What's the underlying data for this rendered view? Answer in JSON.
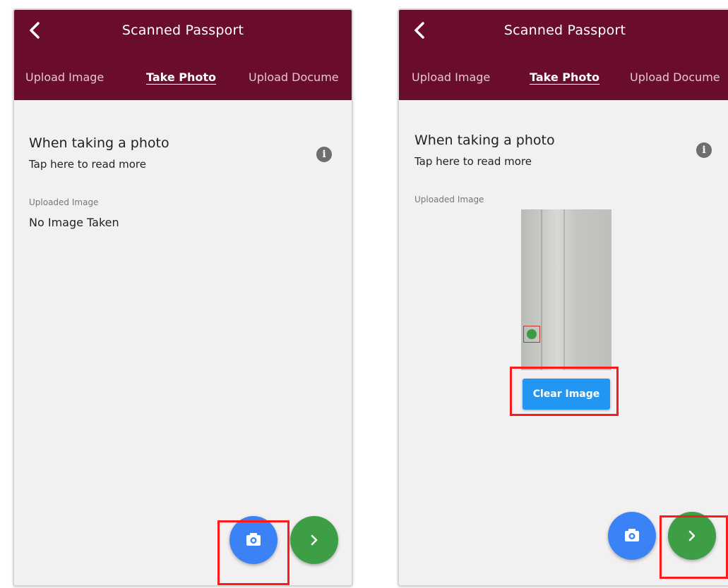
{
  "screens": [
    {
      "id": "before",
      "appbar": {
        "title": "Scanned Passport",
        "back_icon": "chevron-left-icon"
      },
      "tabs": [
        {
          "label": "Upload Image",
          "active": false
        },
        {
          "label": "Take Photo",
          "active": true
        },
        {
          "label": "Upload Docume",
          "active": false
        }
      ],
      "info": {
        "title": "When taking a photo",
        "subtitle": "Tap here to read more",
        "icon": "info-icon"
      },
      "uploaded_label": "Uploaded Image",
      "image_status": "No Image Taken",
      "fabs": [
        {
          "icon": "camera-icon",
          "color": "#3b82f6",
          "highlighted": true
        },
        {
          "icon": "chevron-right-icon",
          "color": "#3e9e46",
          "highlighted": false
        }
      ]
    },
    {
      "id": "after",
      "appbar": {
        "title": "Scanned Passport",
        "back_icon": "chevron-left-icon"
      },
      "tabs": [
        {
          "label": "Upload Image",
          "active": false
        },
        {
          "label": "Take Photo",
          "active": true
        },
        {
          "label": "Upload Docume",
          "active": false
        }
      ],
      "info": {
        "title": "When taking a photo",
        "subtitle": "Tap here to read more",
        "icon": "info-icon"
      },
      "uploaded_label": "Uploaded Image",
      "clear_button": {
        "label": "Clear Image",
        "color": "#2196f3",
        "highlighted": true
      },
      "fabs": [
        {
          "icon": "camera-icon",
          "color": "#3b82f6",
          "highlighted": false
        },
        {
          "icon": "chevron-right-icon",
          "color": "#3e9e46",
          "highlighted": true
        }
      ]
    }
  ],
  "colors": {
    "appbar": "#6a0c2e",
    "background": "#f2f0f1",
    "highlight": "#ff1a1a"
  }
}
